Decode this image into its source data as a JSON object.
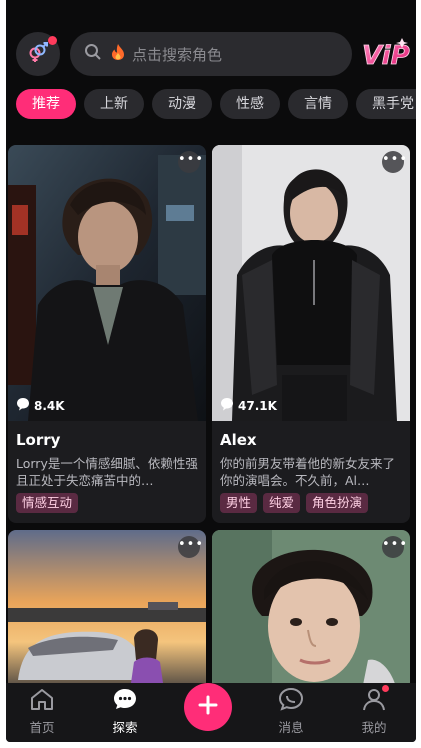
{
  "header": {
    "search_placeholder": "点击搜索角色",
    "vip_label": "ViP"
  },
  "tabs": [
    {
      "label": "推荐",
      "active": true
    },
    {
      "label": "上新"
    },
    {
      "label": "动漫"
    },
    {
      "label": "性感"
    },
    {
      "label": "言情"
    },
    {
      "label": "黑手党"
    }
  ],
  "cards": [
    {
      "views": "8.4K",
      "name": "Lorry",
      "description": "Lorry是一个情感细腻、依赖性强且正处于失恋痛苦中的…",
      "tags": [
        "情感互动"
      ]
    },
    {
      "views": "47.1K",
      "name": "Alex",
      "description": "你的前男友带着他的新女友来了你的演唱会。不久前，Al…",
      "tags": [
        "男性",
        "纯爱",
        "角色扮演"
      ]
    },
    {
      "views": "",
      "name": "",
      "description": "",
      "tags": []
    },
    {
      "views": "",
      "name": "",
      "description": "",
      "tags": []
    }
  ],
  "bottom_nav": {
    "home": "首页",
    "explore": "探索",
    "messages": "消息",
    "profile": "我的"
  },
  "colors": {
    "accent": "#ff2d78",
    "background": "#0b0b0c",
    "card": "#1c1c1f",
    "tag_bg": "#5a2a42"
  }
}
